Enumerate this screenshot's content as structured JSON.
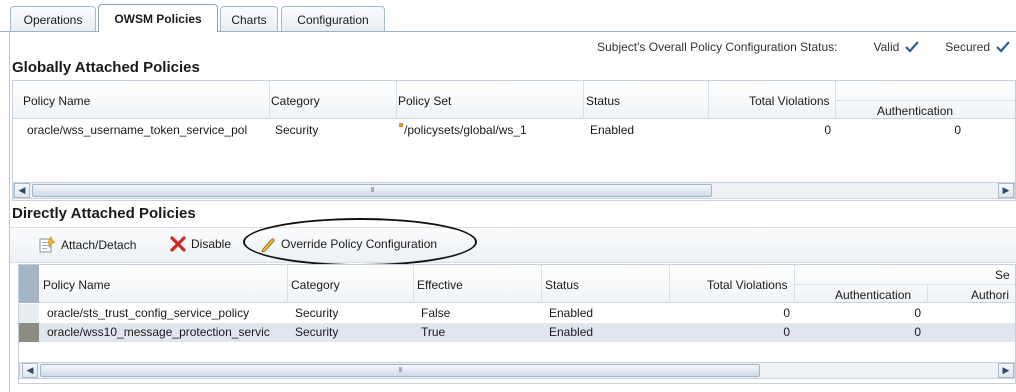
{
  "tabs": [
    {
      "label": "Operations"
    },
    {
      "label": "OWSM Policies"
    },
    {
      "label": "Charts"
    },
    {
      "label": "Configuration"
    }
  ],
  "status": {
    "label": "Subject's Overall Policy Configuration Status:",
    "valid": "Valid",
    "secured": "Secured"
  },
  "global": {
    "title": "Globally Attached Policies",
    "columns": {
      "policy_name": "Policy Name",
      "category": "Category",
      "policy_set": "Policy Set",
      "status": "Status",
      "total_violations": "Total Violations",
      "authentication": "Authentication"
    },
    "rows": [
      {
        "policy_name": "oracle/wss_username_token_service_pol",
        "category": "Security",
        "policy_set": "/policysets/global/ws_1",
        "status": "Enabled",
        "total_violations": "0",
        "authentication": "0"
      }
    ]
  },
  "direct": {
    "title": "Directly Attached Policies",
    "toolbar": {
      "attach": "Attach/Detach",
      "disable": "Disable",
      "override": "Override Policy Configuration"
    },
    "columns": {
      "policy_name": "Policy Name",
      "category": "Category",
      "effective": "Effective",
      "status": "Status",
      "total_violations": "Total Violations",
      "authentication": "Authentication",
      "se": "Se",
      "authori": "Authori"
    },
    "rows": [
      {
        "policy_name": "oracle/sts_trust_config_service_policy",
        "category": "Security",
        "effective": "False",
        "status": "Enabled",
        "total_violations": "0",
        "authentication": "0"
      },
      {
        "policy_name": "oracle/wss10_message_protection_servic",
        "category": "Security",
        "effective": "True",
        "status": "Enabled",
        "total_violations": "0",
        "authentication": "0"
      }
    ]
  },
  "scroll_glyph": "III",
  "colors": {
    "check": "#2c5d96",
    "selected_row": "#dfe6ee",
    "disable_x": "#d2271e"
  }
}
